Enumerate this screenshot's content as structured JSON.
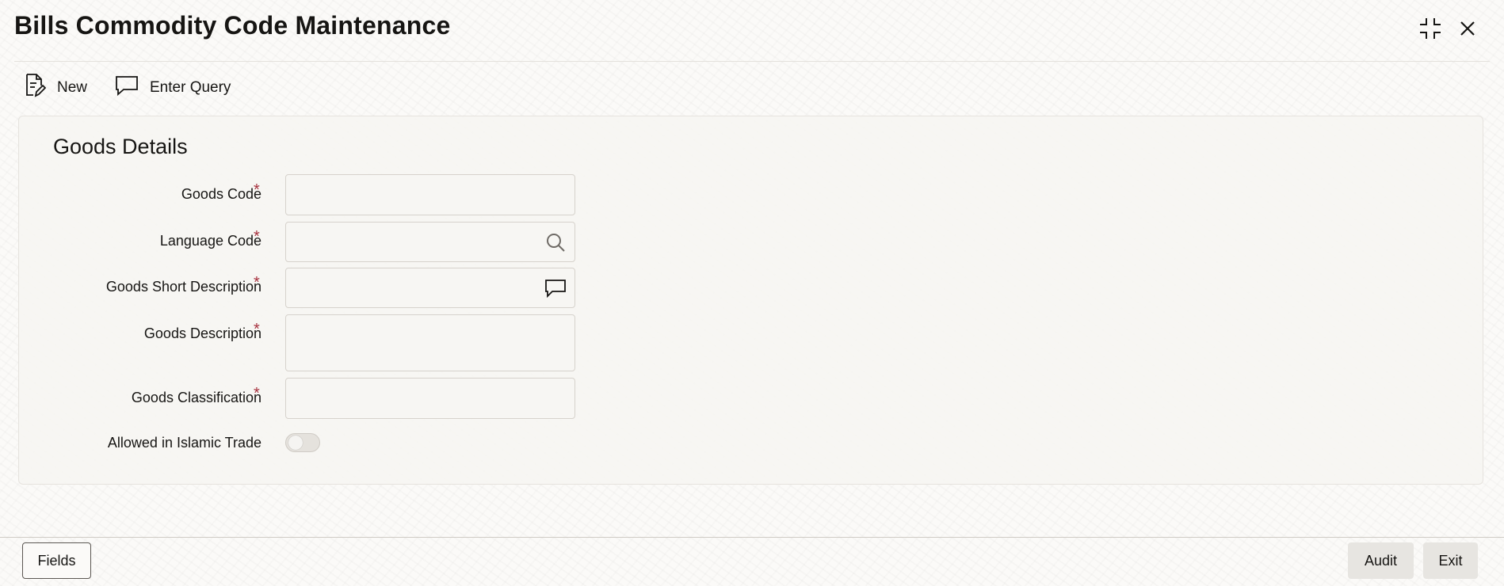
{
  "window": {
    "title": "Bills Commodity Code Maintenance",
    "collapse_icon": "collapse-icon",
    "close_icon": "close-icon"
  },
  "toolbar": {
    "new_label": "New",
    "new_icon": "new-document-icon",
    "enter_query_label": "Enter Query",
    "enter_query_icon": "chat-bubble-icon"
  },
  "section": {
    "title": "Goods Details"
  },
  "form": {
    "goods_code": {
      "label": "Goods Code",
      "required": "*",
      "value": ""
    },
    "language_code": {
      "label": "Language Code",
      "required": "*",
      "value": "",
      "icon": "search-icon"
    },
    "goods_short_description": {
      "label": "Goods Short Description",
      "required": "*",
      "value": "",
      "icon": "chat-bubble-icon"
    },
    "goods_description": {
      "label": "Goods Description",
      "required": "*",
      "value": ""
    },
    "goods_classification": {
      "label": "Goods Classification",
      "required": "*",
      "value": ""
    },
    "allowed_in_islamic_trade": {
      "label": "Allowed in Islamic Trade",
      "checked": false
    }
  },
  "footer": {
    "fields_label": "Fields",
    "audit_label": "Audit",
    "exit_label": "Exit"
  },
  "colors": {
    "required_marker": "#a7323f",
    "text": "#161513",
    "footer_button_bg": "#e7e5e1"
  }
}
